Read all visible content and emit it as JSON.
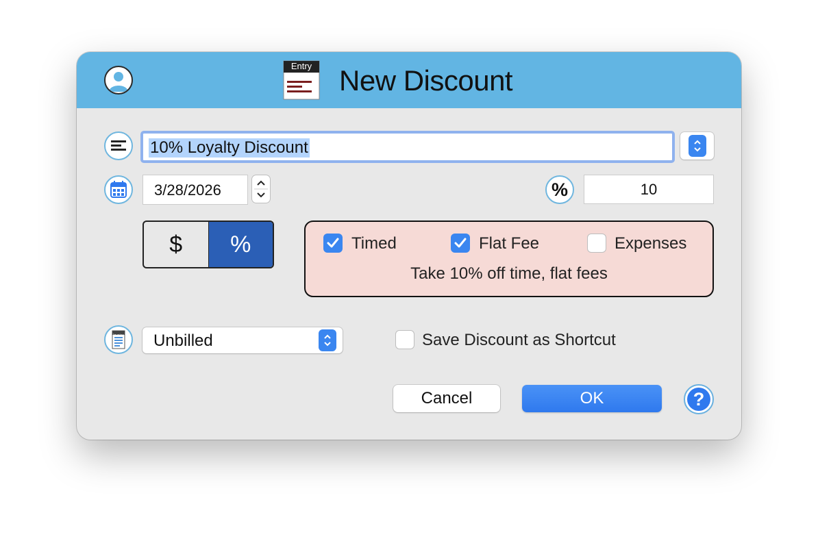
{
  "window": {
    "title": "New Discount",
    "entry_icon_label": "Entry"
  },
  "form": {
    "description": "10% Loyalty Discount",
    "date": "3/28/2026",
    "amount": "10",
    "amount_unit_icon": "%",
    "type_options": [
      "$",
      "%"
    ],
    "type_selected": "%"
  },
  "apply_to": {
    "options": [
      {
        "label": "Timed",
        "checked": true
      },
      {
        "label": "Flat Fee",
        "checked": true
      },
      {
        "label": "Expenses",
        "checked": false
      }
    ],
    "summary": "Take 10% off time, flat fees"
  },
  "billing": {
    "status_icon_label": "Invoice",
    "status": "Unbilled",
    "save_shortcut_label": "Save Discount as Shortcut",
    "save_shortcut_checked": false
  },
  "buttons": {
    "cancel": "Cancel",
    "ok": "OK",
    "help": "?"
  },
  "colors": {
    "header": "#62b5e3",
    "accent": "#3a86f0",
    "apply_box": "#f6dad6",
    "selected_segment": "#2b5fb6"
  },
  "icons": {
    "user": "person-icon",
    "description": "text-lines-icon",
    "date": "calendar-icon",
    "percent": "percent-icon",
    "status": "invoice-icon",
    "help": "question-icon"
  }
}
